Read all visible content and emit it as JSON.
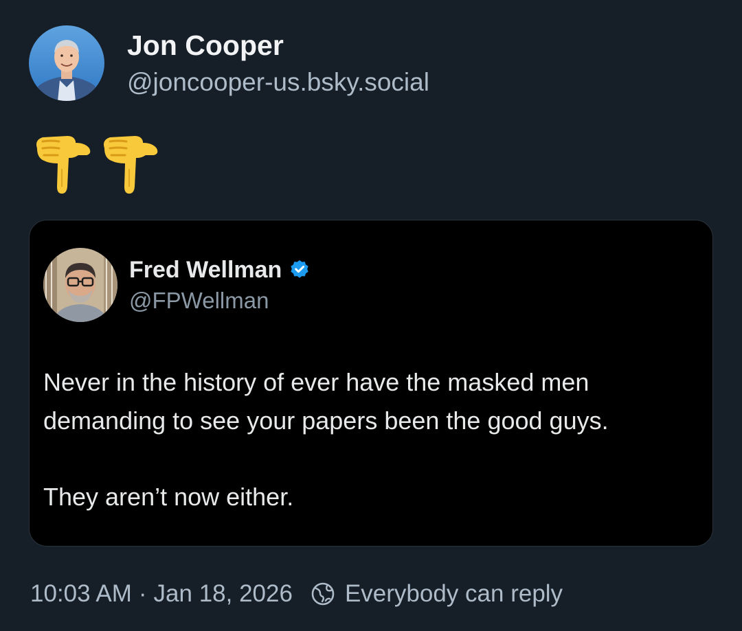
{
  "post": {
    "author": {
      "display_name": "Jon Cooper",
      "handle": "@joncooper-us.bsky.social",
      "avatar_icon": "avatar-photo"
    },
    "emoji": [
      "backhand-index-pointing-down-icon",
      "backhand-index-pointing-down-icon"
    ],
    "quoted": {
      "display_name": "Fred Wellman",
      "verified": true,
      "handle": "@FPWellman",
      "paragraphs": [
        "Never in the history of ever have the masked men demanding to see your papers been the good guys.",
        "They aren’t now either."
      ]
    },
    "meta": {
      "time": "10:03 AM",
      "separator": "·",
      "date": "Jan 18, 2026",
      "reply_setting": "Everybody can reply"
    }
  },
  "colors": {
    "background": "#161e27",
    "quote_background": "#000000",
    "verified_badge": "#1d9bf0",
    "muted_text": "#aebbc9"
  }
}
